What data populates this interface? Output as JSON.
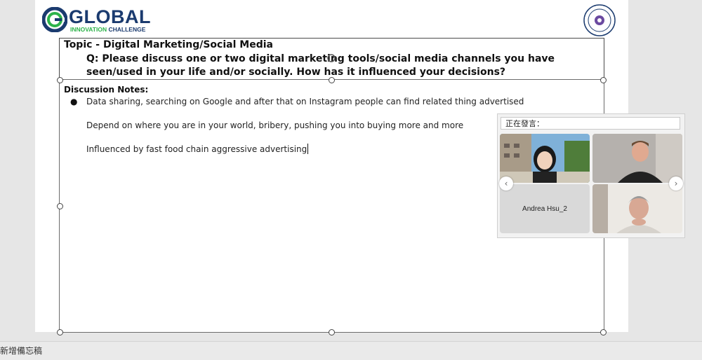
{
  "logo": {
    "word": "GLOBAL",
    "tag_green": "INNOVATION",
    "tag_rest": " CHALLENGE"
  },
  "slide": {
    "topic": "Topic - Digital Marketing/Social Media",
    "question": "Q: Please discuss one or two digital marketing tools/social media channels you have seen/used in your life and/or socially. How has it influenced your decisions?",
    "notes_heading": "Discussion Notes:",
    "bullet": "●",
    "notes": [
      "Data sharing, searching on Google and after that on Instagram people can find related thing advertised",
      "Depend on where you are in your world, bribery, pushing you into buying more and more",
      "Influenced by fast food chain aggressive advertising"
    ]
  },
  "video_panel": {
    "speaking_label": "正在發言：",
    "participant_name": "Andrea Hsu_2",
    "prev_icon": "‹",
    "next_icon": "›"
  },
  "status_bar": {
    "notes_hint": "新增備忘稿"
  },
  "colors": {
    "brand_blue": "#1b3b6f",
    "brand_green": "#2db34a"
  }
}
